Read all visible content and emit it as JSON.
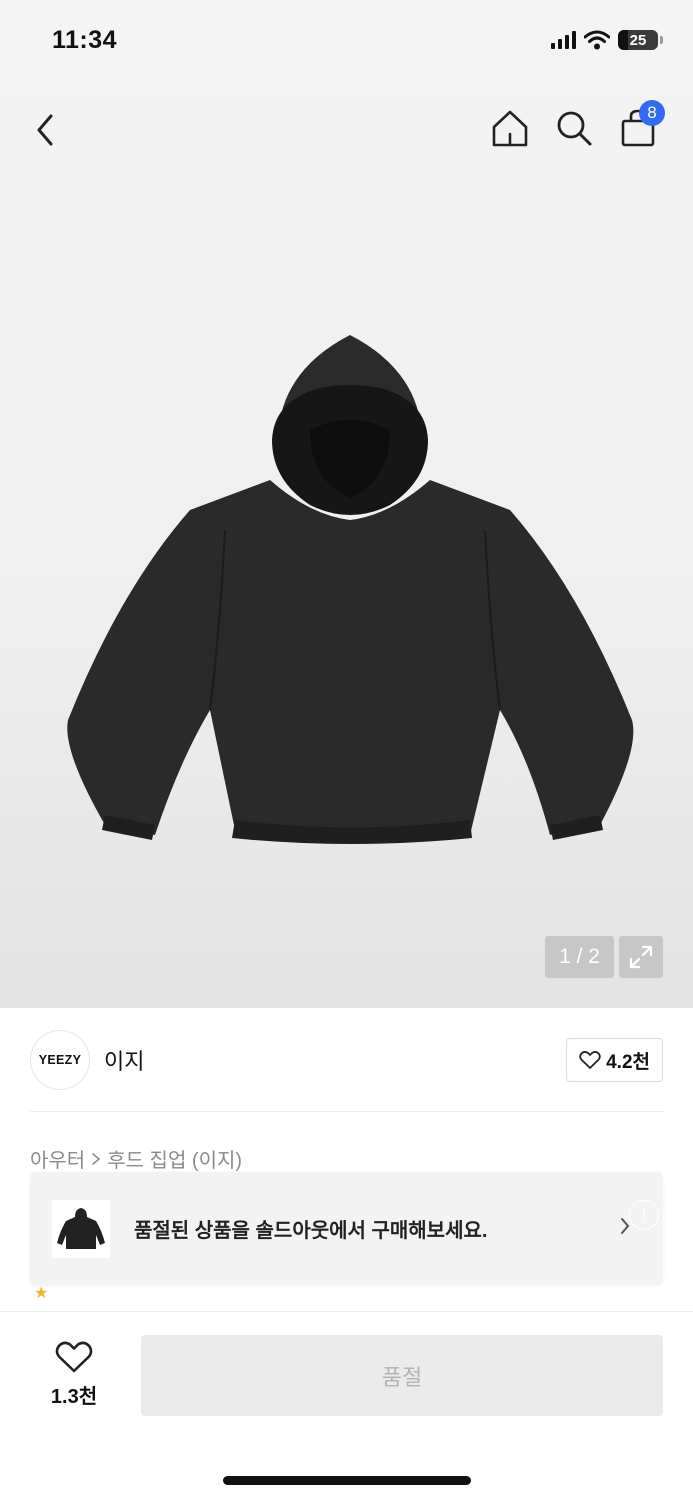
{
  "status_bar": {
    "time": "11:34",
    "battery": "25"
  },
  "nav": {
    "cart_count": "8"
  },
  "gallery": {
    "counter": "1 / 2"
  },
  "brand": {
    "logo_text": "YEEZY",
    "name": "이지",
    "like_count": "4.2천"
  },
  "breadcrumb": {
    "category": "아우터",
    "subcategory": "후드 집업 (이지)"
  },
  "soldout_banner": {
    "text": "품절된 상품을 솔드아웃에서 구매해보세요."
  },
  "bottom_bar": {
    "wish_count": "1.3천",
    "action_label": "품절"
  },
  "colors": {
    "accent": "#2f6bf5",
    "disabled_bg": "#ebebeb",
    "disabled_text": "#b4b4b4"
  }
}
